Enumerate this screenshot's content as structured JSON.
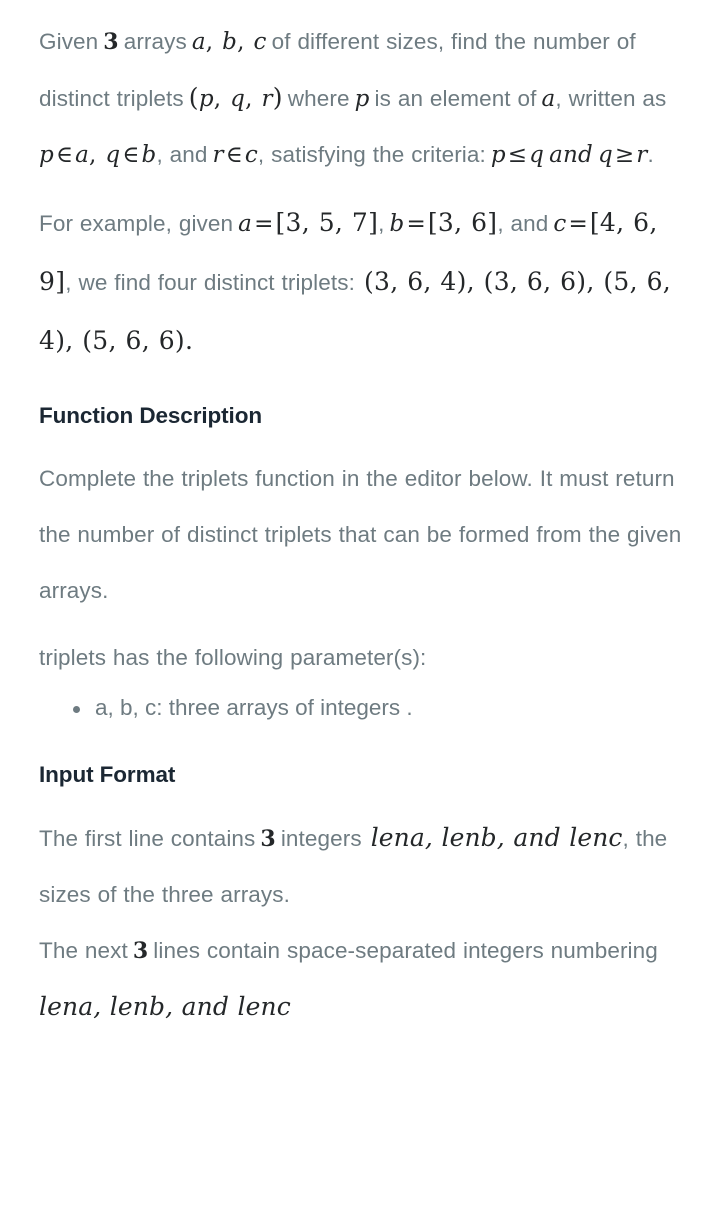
{
  "document": {
    "background_color": "#ffffff",
    "body_text_color": "#6e7b81",
    "math_text_color": "#242729",
    "heading_color": "#1b2733"
  },
  "problem": {
    "intro": {
      "part1": "Given",
      "count_3": "3",
      "part2": "arrays",
      "array_a": "a",
      "comma1": ",",
      "array_b": "b",
      "comma2": ",",
      "array_c": "c",
      "part3": "of different sizes, find the number of distinct triplets",
      "triplet_open": "(",
      "triplet_p": "p",
      "triplet_comma1": ",",
      "triplet_q": "q",
      "triplet_comma2": ",",
      "triplet_r": "r",
      "triplet_close": ")",
      "part4": "where",
      "var_p": "p",
      "part5": "is an element of",
      "var_a": "a",
      "part6": ", written as",
      "member_p": "p",
      "member_in1": "∈",
      "member_a": "a",
      "member_comma": ",",
      "member_q": "q",
      "member_in2": "∈",
      "member_b": "b",
      "part7": ", and",
      "member_r": "r",
      "member_in3": "∈",
      "member_c": "c",
      "part8": ", satisfying the criteria:",
      "crit_p": "p",
      "crit_le": "≤",
      "crit_q": "q",
      "crit_and": "and",
      "crit_q2": "q",
      "crit_ge": "≥",
      "crit_r": "r",
      "period": "."
    },
    "example": {
      "lead": "For example, given",
      "a_name": "a",
      "eq1": "=",
      "a_value": "[3, 5, 7]",
      "sep1": ",",
      "b_name": "b",
      "eq2": "=",
      "b_value": "[3, 6]",
      "sep2": ", and",
      "c_name": "c",
      "eq3": "=",
      "c_value": "[4, 6, 9]",
      "tail": ", we find four distinct triplets:",
      "triplets": "(3, 6, 4), (3, 6, 6), (5, 6, 4), (5, 6, 6)."
    },
    "function_description": {
      "heading": "Function Description",
      "paragraph": "Complete the triplets function in the editor below. It must return the number of distinct triplets that can be formed from the given arrays.",
      "params_lead": "triplets has the following parameter(s):",
      "params": [
        "a, b, c: three arrays of integers ."
      ]
    },
    "input_format": {
      "heading": "Input Format",
      "line1_pre": "The first line contains",
      "line1_count": "3",
      "line1_post": "integers",
      "line1_vars": "lena, lenb, and lenc",
      "line1_tail": ", the sizes of the three arrays.",
      "line2_pre": "The next",
      "line2_count": "3",
      "line2_post": "lines contain space-separated integers numbering",
      "line2_vars": "lena, lenb, and lenc"
    }
  }
}
